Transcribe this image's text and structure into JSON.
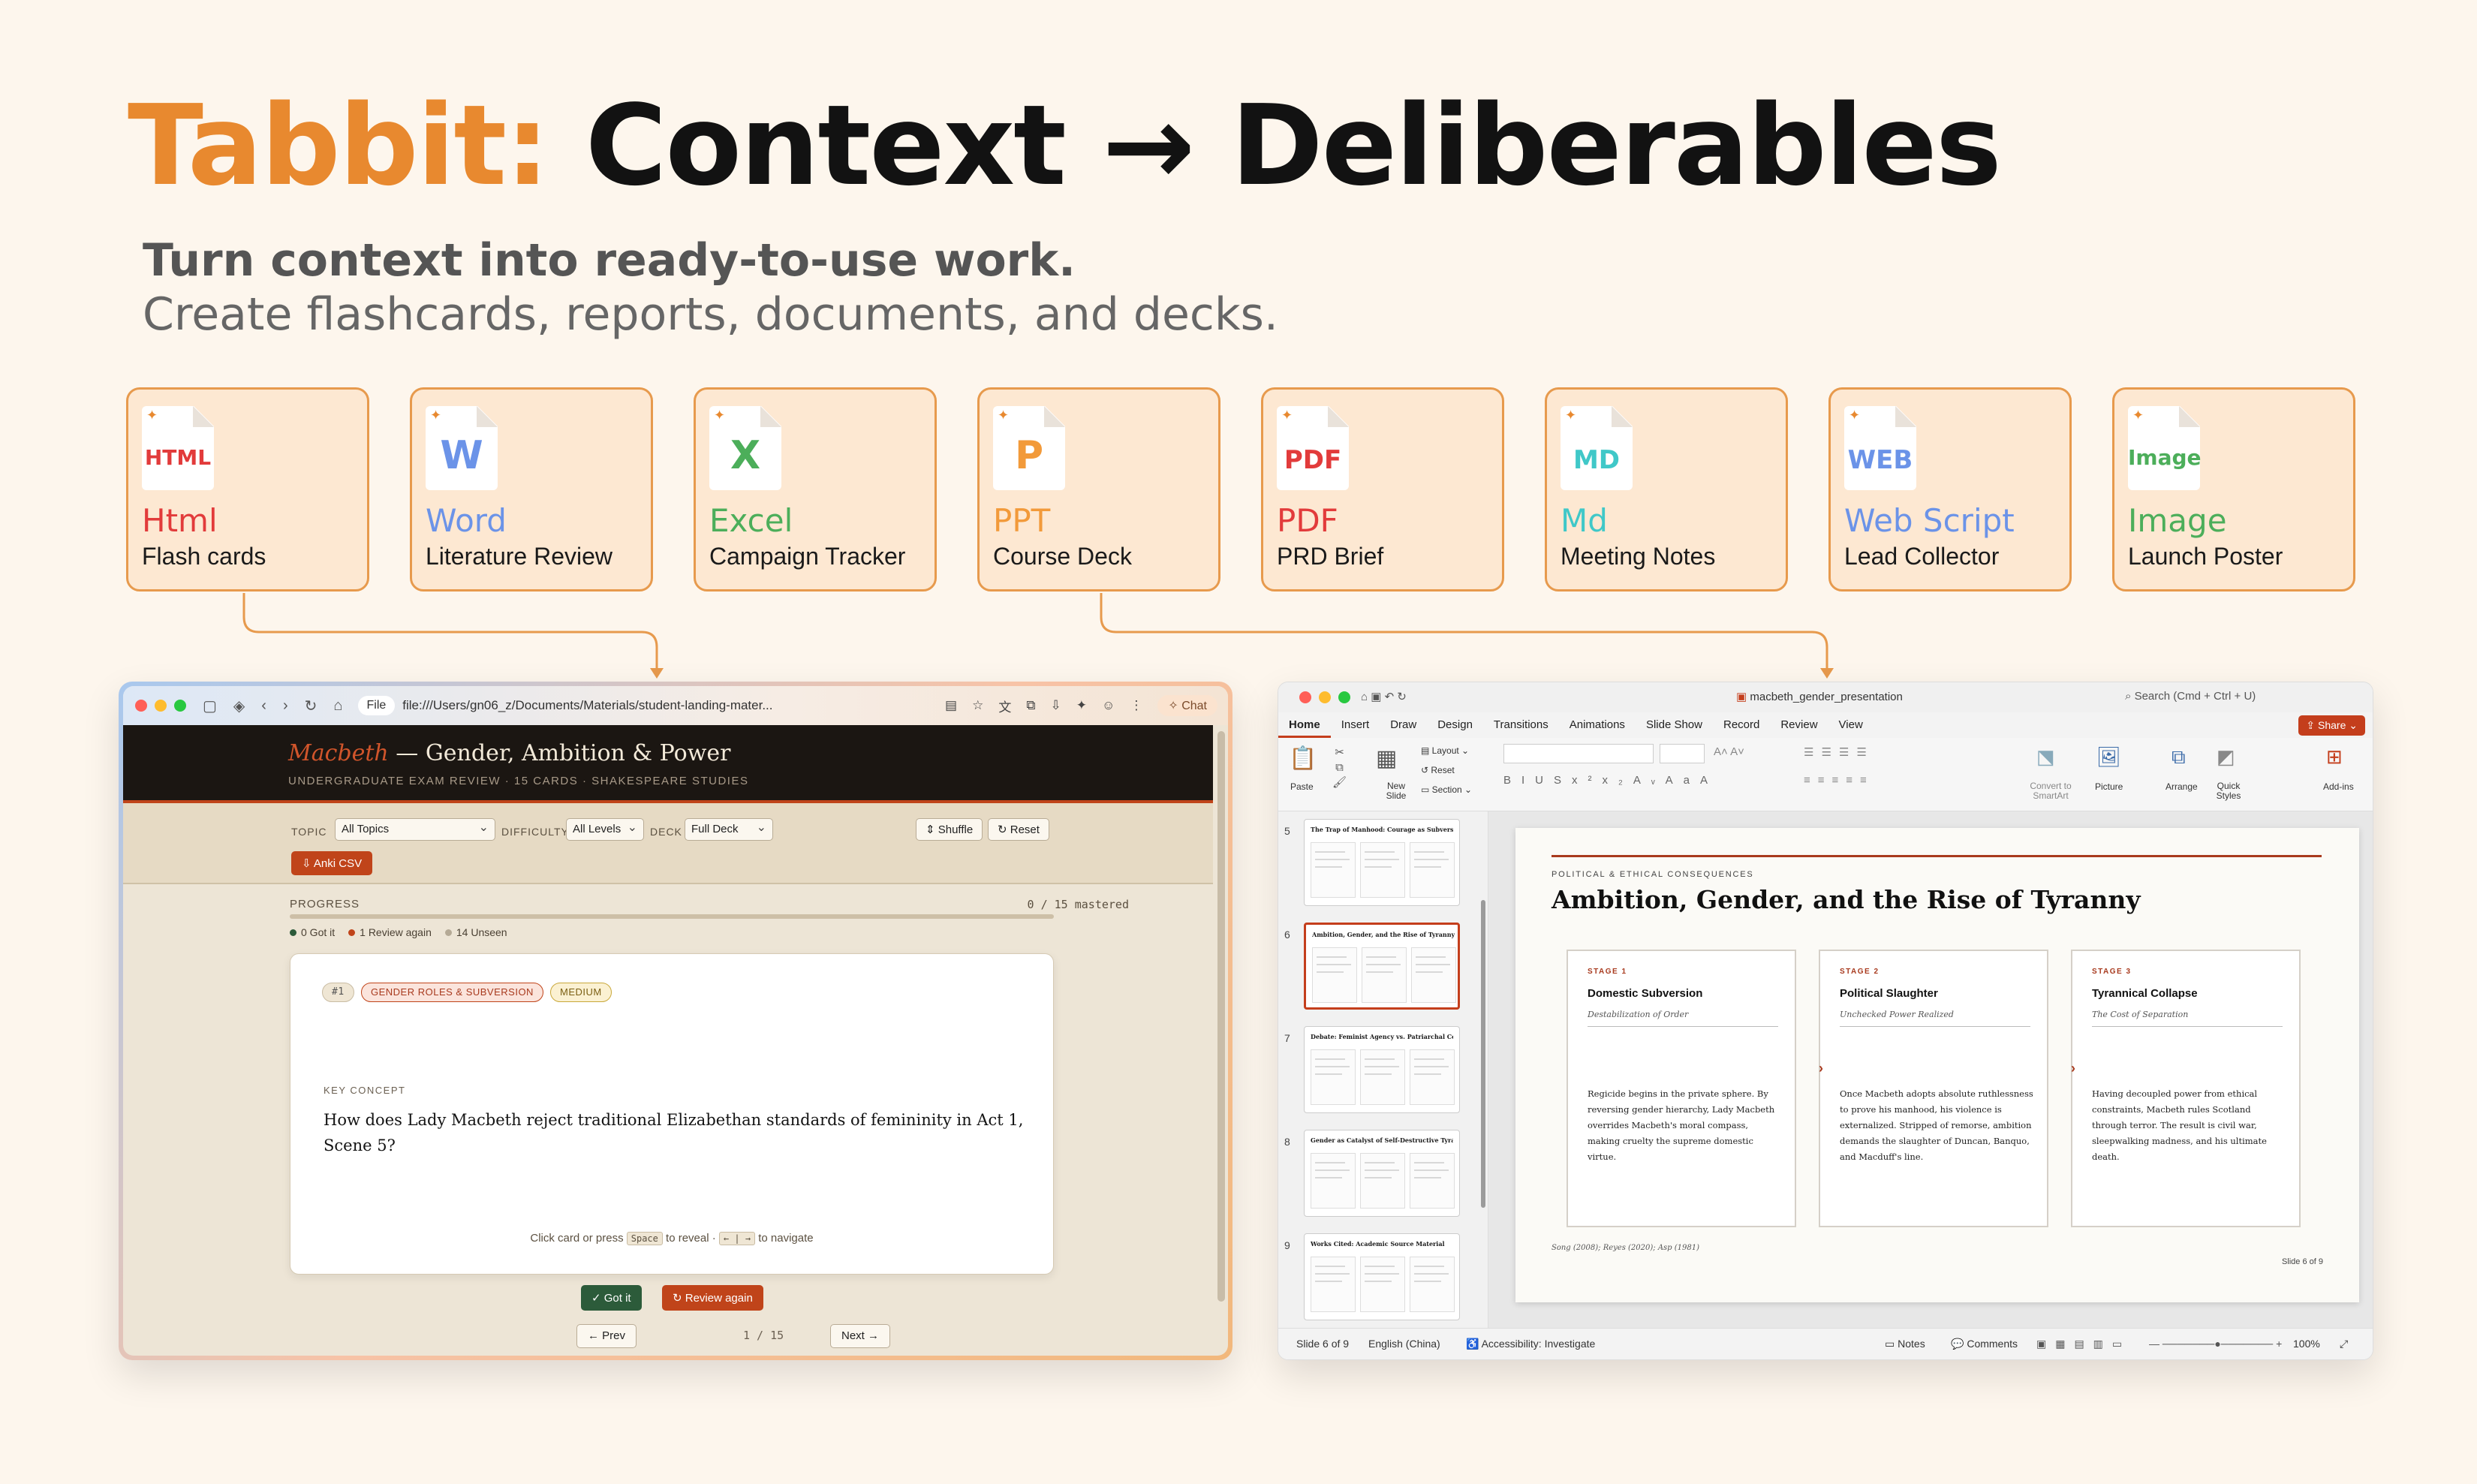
{
  "hero": {
    "brand": "Tabbit:",
    "rest": "Context → Deliberables",
    "line1": "Turn context into ready-to-use work.",
    "line2": "Create flashcards, reports, documents, and decks."
  },
  "cards": [
    {
      "icon_label": "HTML",
      "type": "Html",
      "desc": "Flash cards",
      "color": "#e23b3b"
    },
    {
      "icon_label": "W",
      "type": "Word",
      "desc": "Literature Review",
      "color": "#6b93e8"
    },
    {
      "icon_label": "X",
      "type": "Excel",
      "desc": "Campaign Tracker",
      "color": "#4cae5a"
    },
    {
      "icon_label": "P",
      "type": "PPT",
      "desc": "Course Deck",
      "color": "#f29a3a"
    },
    {
      "icon_label": "PDF",
      "type": "PDF",
      "desc": "PRD Brief",
      "color": "#e23b3b"
    },
    {
      "icon_label": "MD",
      "type": "Md",
      "desc": "Meeting Notes",
      "color": "#40c8c8"
    },
    {
      "icon_label": "WEB",
      "type": "Web Script",
      "desc": "Lead Collector",
      "color": "#6b93e8"
    },
    {
      "icon_label": "Image",
      "type": "Image",
      "desc": "Launch Poster",
      "color": "#4cae5a"
    }
  ],
  "browser": {
    "file_pill": "File",
    "url": "file:///Users/gn06_z/Documents/Materials/student-landing-mater...",
    "chat": "Chat",
    "title_italic": "Macbeth",
    "title_rest": " — Gender, Ambition & Power",
    "subtitle": "UNDERGRADUATE EXAM REVIEW · 15 CARDS · SHAKESPEARE STUDIES",
    "filters": {
      "topic_label": "TOPIC",
      "topic_value": "All Topics",
      "difficulty_label": "DIFFICULTY",
      "difficulty_value": "All Levels",
      "deck_label": "DECK",
      "deck_value": "Full Deck",
      "shuffle": "⇕ Shuffle",
      "reset": "↻ Reset",
      "anki": "⇩ Anki CSV"
    },
    "progress": {
      "label": "PROGRESS",
      "count": "0 / 15 mastered",
      "fraction": 0,
      "got_it": "0 Got it",
      "review_again": "1 Review again",
      "unseen": "14 Unseen"
    },
    "card": {
      "number": "#1",
      "topic_tag": "GENDER ROLES & SUBVERSION",
      "difficulty_tag": "MEDIUM",
      "kind": "KEY CONCEPT",
      "question": "How does Lady Macbeth reject traditional Elizabethan standards of femininity in Act 1, Scene 5?",
      "hint_pre": "Click card or press",
      "hint_key1": "Space",
      "hint_mid": "to reveal ·",
      "hint_key2": "← | →",
      "hint_post": "to navigate"
    },
    "actions": {
      "got_it": "✓ Got it",
      "review_again": "↻ Review again",
      "prev": "← Prev",
      "next": "Next →",
      "page": "1 / 15"
    }
  },
  "ppt": {
    "filename": "macbeth_gender_presentation",
    "search": "Search (Cmd + Ctrl + U)",
    "share": "Share",
    "tabs": [
      "Home",
      "Insert",
      "Draw",
      "Design",
      "Transitions",
      "Animations",
      "Slide Show",
      "Record",
      "Review",
      "View"
    ],
    "ribbon": {
      "paste": "Paste",
      "new_slide": "New Slide",
      "layout": "Layout",
      "reset": "Reset",
      "section": "Section",
      "convert": "Convert to SmartArt",
      "picture": "Picture",
      "arrange": "Arrange",
      "quick_styles": "Quick Styles",
      "addins": "Add-ins"
    },
    "thumbs": [
      {
        "num": "5",
        "title": "The Trap of Manhood: Courage as Subversion"
      },
      {
        "num": "6",
        "title": "Ambition, Gender, and the Rise of Tyranny"
      },
      {
        "num": "7",
        "title": "Debate: Feminist Agency vs. Patriarchal Co-optation"
      },
      {
        "num": "8",
        "title": "Gender as Catalyst of Self-Destructive Tyranny"
      },
      {
        "num": "9",
        "title": "Works Cited: Academic Source Material"
      }
    ],
    "slide": {
      "kicker": "POLITICAL & ETHICAL CONSEQUENCES",
      "title": "Ambition, Gender, and the Rise of Tyranny",
      "stages": [
        {
          "num": "STAGE 1",
          "name": "Domestic Subversion",
          "sub": "Destabilization of Order",
          "body": "Regicide begins in the private sphere. By reversing gender hierarchy, Lady Macbeth overrides Macbeth's moral compass, making cruelty the supreme domestic virtue."
        },
        {
          "num": "STAGE 2",
          "name": "Political Slaughter",
          "sub": "Unchecked Power Realized",
          "body": "Once Macbeth adopts absolute ruthlessness to prove his manhood, his violence is externalized. Stripped of remorse, ambition demands the slaughter of Duncan, Banquo, and Macduff's line."
        },
        {
          "num": "STAGE 3",
          "name": "Tyrannical Collapse",
          "sub": "The Cost of Separation",
          "body": "Having decoupled power from ethical constraints, Macbeth rules Scotland through terror. The result is civil war, sleepwalking madness, and his ultimate death."
        }
      ],
      "cite": "Song (2008); Reyes (2020); Asp (1981)",
      "page": "Slide 6 of 9"
    },
    "status": {
      "slide": "Slide 6 of 9",
      "lang": "English (China)",
      "access": "Accessibility: Investigate",
      "notes": "Notes",
      "comments": "Comments",
      "zoom": "100%"
    }
  }
}
